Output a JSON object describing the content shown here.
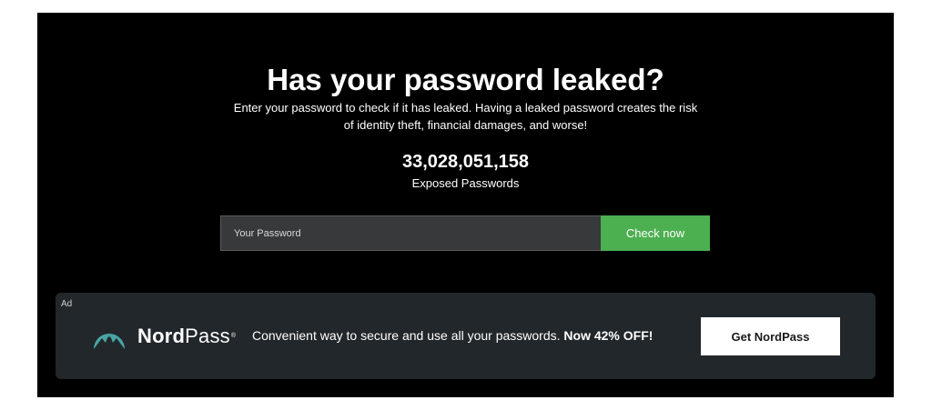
{
  "hero": {
    "title": "Has your password leaked?",
    "description": "Enter your password to check if it has leaked. Having a leaked password creates the risk of identity theft, financial damages, and worse!",
    "count_value": "33,028,051,158",
    "count_label": "Exposed Passwords"
  },
  "search": {
    "placeholder": "Your Password",
    "value": "",
    "button_label": "Check now",
    "button_color": "#4caf50"
  },
  "ad": {
    "label": "Ad",
    "brand_icon": "nordpass-mountain-logo-icon",
    "brand_bold": "Nord",
    "brand_regular": "Pass",
    "brand_mark": "®",
    "tagline": "Convenient way to secure and use all your passwords.",
    "tagline_offer": "Now 42% OFF!",
    "cta_label": "Get NordPass",
    "brand_color": "#4aa6a6"
  }
}
